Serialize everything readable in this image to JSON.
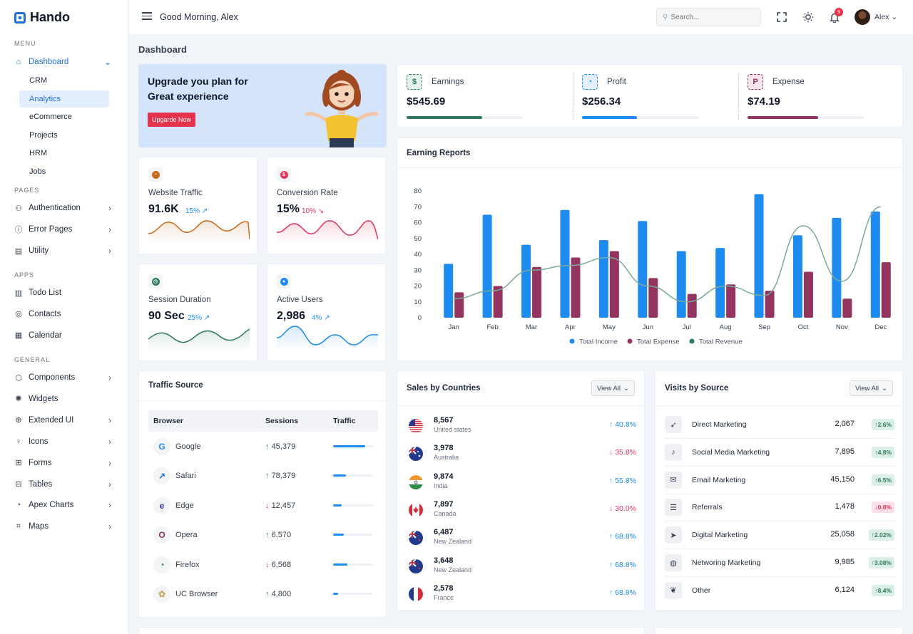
{
  "brand": "Hando",
  "sidebar": {
    "menu_label": "MENU",
    "dashboard": "Dashboard",
    "dashboard_sub": [
      "CRM",
      "Analytics",
      "eCommerce",
      "Projects",
      "HRM",
      "Jobs"
    ],
    "active_sub": "Analytics",
    "pages_label": "PAGES",
    "pages": [
      "Authentication",
      "Error Pages",
      "Utility"
    ],
    "apps_label": "APPS",
    "apps": [
      "Todo List",
      "Contacts",
      "Calendar"
    ],
    "general_label": "GENERAL",
    "general": [
      "Components",
      "Widgets",
      "Extended UI",
      "Icons",
      "Forms",
      "Tables",
      "Apex Charts",
      "Maps"
    ]
  },
  "topbar": {
    "greeting": "Good Morning, Alex",
    "search_placeholder": "Search...",
    "notification_count": "9",
    "user": "Alex"
  },
  "page_title": "Dashboard",
  "upgrade": {
    "title": "Upgrade you plan for Great experience",
    "button": "Upgarde Now"
  },
  "mini_stats": [
    {
      "label": "Website Traffic",
      "value": "91.6K",
      "pct": "15%",
      "trend": "up",
      "color": "#c8691c"
    },
    {
      "label": "Conversion Rate",
      "value": "15%",
      "pct": "10%",
      "trend": "down",
      "color": "#e5335e"
    },
    {
      "label": "Session Duration",
      "value": "90 Sec",
      "pct": "25%",
      "trend": "up",
      "color": "#2f7a5c"
    },
    {
      "label": "Active Users",
      "value": "2,986",
      "pct": "4%",
      "trend": "up",
      "color": "#1e8bf0"
    }
  ],
  "summary": [
    {
      "label": "Earnings",
      "value": "$545.69",
      "progress": 0.65,
      "color": "#2f7a5c"
    },
    {
      "label": "Profit",
      "value": "$256.34",
      "progress": 0.47,
      "color": "#1e8bf0"
    },
    {
      "label": "Expense",
      "value": "$74.19",
      "progress": 0.61,
      "color": "#933461"
    }
  ],
  "earning_reports": {
    "title": "Earning Reports",
    "chart_data": {
      "type": "bar",
      "categories": [
        "Jan",
        "Feb",
        "Mar",
        "Apr",
        "May",
        "Jun",
        "Jul",
        "Aug",
        "Sep",
        "Oct",
        "Nov",
        "Dec"
      ],
      "ylim": [
        0,
        80
      ],
      "yticks": [
        0,
        10,
        20,
        30,
        40,
        50,
        60,
        70,
        80
      ],
      "series": [
        {
          "name": "Total Income",
          "type": "bar",
          "color": "#1e8bf0",
          "values": [
            34,
            65,
            46,
            68,
            49,
            61,
            42,
            44,
            78,
            52,
            63,
            67
          ]
        },
        {
          "name": "Total Expense",
          "type": "bar",
          "color": "#933461",
          "values": [
            16,
            20,
            32,
            38,
            42,
            25,
            15,
            21,
            17,
            29,
            12,
            35
          ]
        },
        {
          "name": "Total Revenue",
          "type": "line",
          "color": "#7aa99a",
          "values": [
            12,
            17,
            30,
            33,
            38,
            20,
            10,
            20,
            14,
            58,
            23,
            70
          ]
        }
      ]
    }
  },
  "traffic_source": {
    "title": "Traffic Source",
    "headers": [
      "Browser",
      "Sessions",
      "Traffic"
    ],
    "rows": [
      {
        "browser": "Google",
        "sessions": "45,379",
        "trend": "up",
        "traffic": 0.8,
        "icon": "G",
        "icon_color": "#1e8bf0"
      },
      {
        "browser": "Safari",
        "sessions": "78,379",
        "trend": "up",
        "traffic": 0.33,
        "icon": "↗",
        "icon_color": "#1e6fd9"
      },
      {
        "browser": "Edge",
        "sessions": "12,457",
        "trend": "down",
        "traffic": 0.22,
        "icon": "e",
        "icon_color": "#3730a3"
      },
      {
        "browser": "Opera",
        "sessions": "6,570",
        "trend": "up",
        "traffic": 0.26,
        "icon": "O",
        "icon_color": "#933461"
      },
      {
        "browser": "Firefox",
        "sessions": "6,568",
        "trend": "down",
        "traffic": 0.35,
        "icon": "◔",
        "icon_color": "#2f7a5c"
      },
      {
        "browser": "UC Browser",
        "sessions": "4,800",
        "trend": "up",
        "traffic": 0.13,
        "icon": "✿",
        "icon_color": "#c8a86a"
      }
    ]
  },
  "sales_by_countries": {
    "title": "Sales by Countries",
    "view_all": "View All",
    "rows": [
      {
        "value": "8,567",
        "country": "United states",
        "pct": "40.8%",
        "trend": "up",
        "flag": "us"
      },
      {
        "value": "3,978",
        "country": "Australia",
        "pct": "35.8%",
        "trend": "down",
        "flag": "au"
      },
      {
        "value": "9,874",
        "country": "India",
        "pct": "55.8%",
        "trend": "up",
        "flag": "in"
      },
      {
        "value": "7,897",
        "country": "Canada",
        "pct": "30.0%",
        "trend": "down",
        "flag": "ca"
      },
      {
        "value": "6,487",
        "country": "New Zealand",
        "pct": "68.8%",
        "trend": "up",
        "flag": "nz"
      },
      {
        "value": "3,648",
        "country": "New Zealand",
        "pct": "68.8%",
        "trend": "up",
        "flag": "nz"
      },
      {
        "value": "2,578",
        "country": "France",
        "pct": "68.8%",
        "trend": "up",
        "flag": "fr"
      }
    ]
  },
  "visits_by_source": {
    "title": "Visits by Source",
    "view_all": "View All",
    "rows": [
      {
        "name": "Direct Marketing",
        "value": "2,067",
        "pct": "2.6%",
        "trend": "up",
        "icon": "rocket-icon"
      },
      {
        "name": "Social Media Marketing",
        "value": "7,895",
        "pct": "4.8%",
        "trend": "up",
        "icon": "music-icon"
      },
      {
        "name": "Email Marketing",
        "value": "45,150",
        "pct": "6.5%",
        "trend": "up",
        "icon": "mail-icon"
      },
      {
        "name": "Referrals",
        "value": "1,478",
        "pct": "0.8%",
        "trend": "down",
        "icon": "stack-icon"
      },
      {
        "name": "Digital Marketing",
        "value": "25,058",
        "pct": "2.02%",
        "trend": "up",
        "icon": "send-icon"
      },
      {
        "name": "Networing Marketing",
        "value": "9,985",
        "pct": "3.08%",
        "trend": "up",
        "icon": "planet-icon"
      },
      {
        "name": "Other",
        "value": "6,124",
        "pct": "8.4%",
        "trend": "up",
        "icon": "drop-icon"
      }
    ]
  }
}
